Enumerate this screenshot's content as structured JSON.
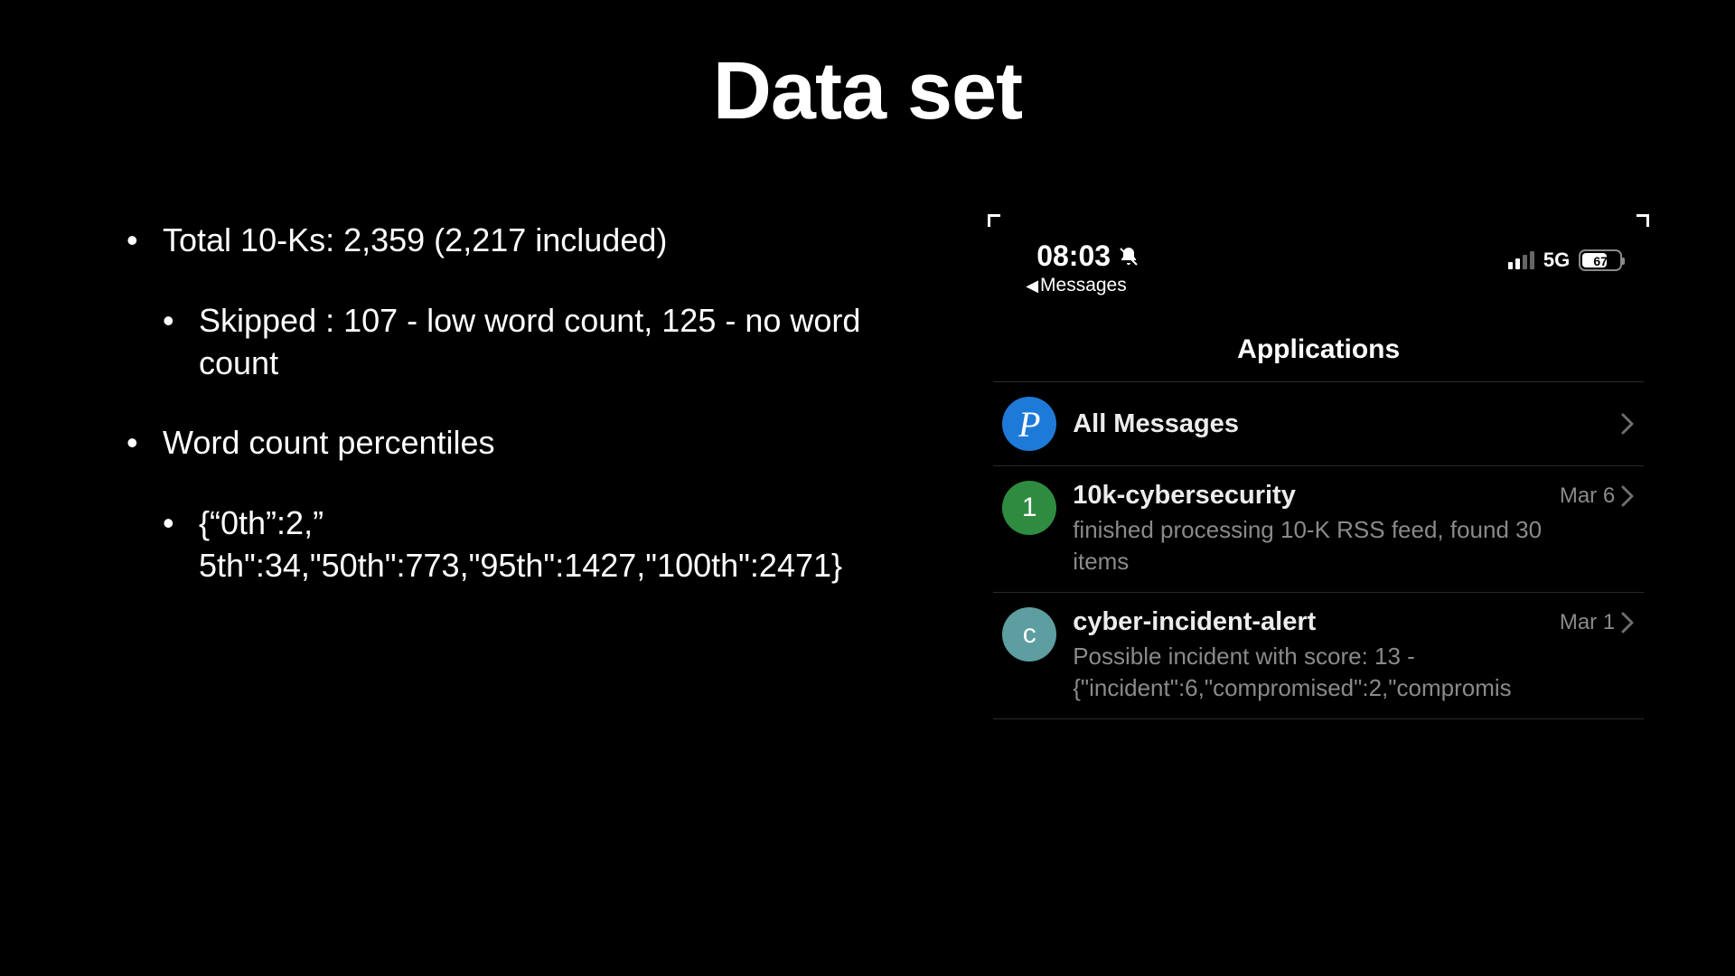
{
  "title": "Data set",
  "bullets": {
    "b1": "Total 10-Ks: 2,359 (2,217 included)",
    "b1a": "Skipped : 107 - low word count, 125 - no word count",
    "b2": "Word count percentiles",
    "b2a": "{“0th”:2,” 5th\":34,\"50th\":773,\"95th\":1427,\"100th\":2471}"
  },
  "phone": {
    "time": "08:03",
    "back_label": "Messages",
    "network": "5G",
    "battery": "67",
    "header": "Applications",
    "rows": [
      {
        "avatar": "P",
        "title": "All Messages",
        "date": "",
        "sub": ""
      },
      {
        "avatar": "1",
        "title": "10k-cybersecurity",
        "date": "Mar 6",
        "sub": "finished processing 10-K RSS feed, found 30 items"
      },
      {
        "avatar": "c",
        "title": "cyber-incident-alert",
        "date": "Mar 1",
        "sub": "Possible incident with score: 13 - {\"incident\":6,\"compromised\":2,\"compromis"
      }
    ]
  }
}
